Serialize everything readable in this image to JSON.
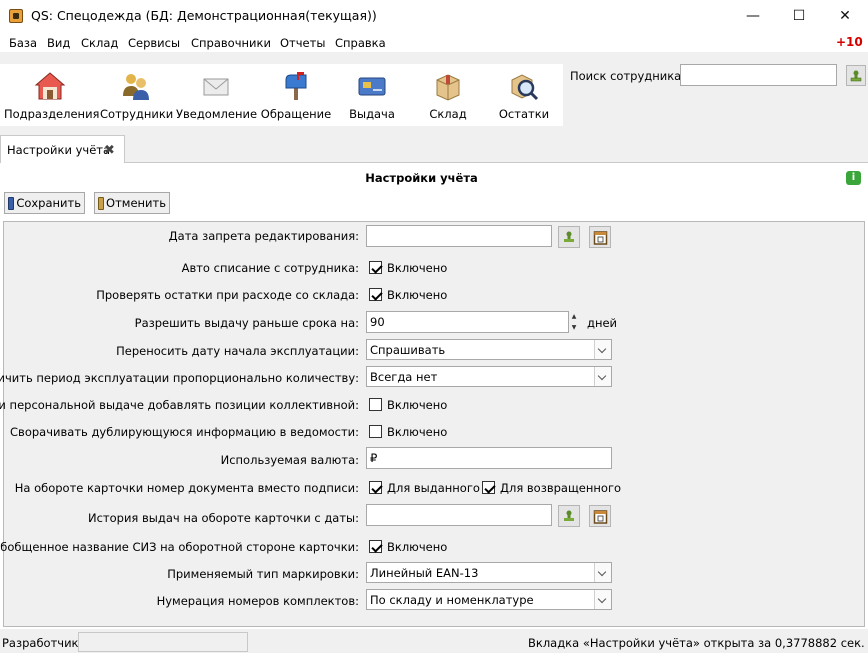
{
  "window": {
    "title": "QS: Спецодежда (БД: Демонстрационная(текущая))",
    "minimize": "—",
    "maximize": "☐",
    "close": "✕"
  },
  "menu": {
    "items": [
      "База",
      "Вид",
      "Склад",
      "Сервисы",
      "Справочники",
      "Отчеты",
      "Справка"
    ],
    "badge": "+10"
  },
  "toolbar": {
    "buttons": [
      {
        "label": "Подразделения",
        "icon": "house-icon"
      },
      {
        "label": "Сотрудники",
        "icon": "people-icon"
      },
      {
        "label": "Уведомление",
        "icon": "envelope-icon"
      },
      {
        "label": "Обращение",
        "icon": "mailbox-icon"
      },
      {
        "label": "Выдача",
        "icon": "card-icon"
      },
      {
        "label": "Склад",
        "icon": "box-icon"
      },
      {
        "label": "Остатки",
        "icon": "magnifier-box-icon"
      }
    ]
  },
  "search": {
    "label": "Поиск сотрудника:",
    "value": ""
  },
  "tab": {
    "label": "Настройки учёта",
    "close": "✖"
  },
  "panel": {
    "title": "Настройки учёта",
    "info": "i",
    "save_label": "Сохранить",
    "cancel_label": "Отменить"
  },
  "form": {
    "edit_ban_date": {
      "label": "Дата запрета редактирования:",
      "value": ""
    },
    "auto_writeoff": {
      "label": "Авто списание с сотрудника:",
      "checked": true,
      "text": "Включено"
    },
    "check_stock": {
      "label": "Проверять остатки при расходе со склада:",
      "checked": true,
      "text": "Включено"
    },
    "early_issue": {
      "label": "Разрешить выдачу раньше срока на:",
      "value": "90",
      "unit": "дней"
    },
    "transfer_start_date": {
      "label": "Переносить дату начала эксплуатации:",
      "value": "Спрашивать"
    },
    "extend_period": {
      "label": "Увеличить период эксплуатации пропорционально количеству:",
      "value": "Всегда нет"
    },
    "personal_add_collective": {
      "label": "При персональной выдаче добавлять позиции коллективной:",
      "checked": false,
      "text": "Включено"
    },
    "collapse_duplicate": {
      "label": "Сворачивать дублирующуюся информацию в ведомости:",
      "checked": false,
      "text": "Включено"
    },
    "currency": {
      "label": "Используемая валюта:",
      "value": "₽"
    },
    "doc_number_back": {
      "label": "На обороте карточки номер документа вместо подписи:",
      "issued_checked": true,
      "issued_text": "Для выданного",
      "returned_checked": true,
      "returned_text": "Для возвращенного"
    },
    "history_from_date": {
      "label": "История выдач на обороте карточки с даты:",
      "value": ""
    },
    "generic_siz_name": {
      "label": "Обобщенное название СИЗ на оборотной стороне карточки:",
      "checked": true,
      "text": "Включено"
    },
    "marking_type": {
      "label": "Применяемый тип маркировки:",
      "value": "Линейный EAN-13"
    },
    "kit_numbering": {
      "label": "Нумерация номеров комплектов:",
      "value": "По складу и номенклатуре"
    }
  },
  "status": {
    "left": "Разработчик",
    "right": "Вкладка «Настройки учёта» открыта за 0,3778882 сек."
  }
}
